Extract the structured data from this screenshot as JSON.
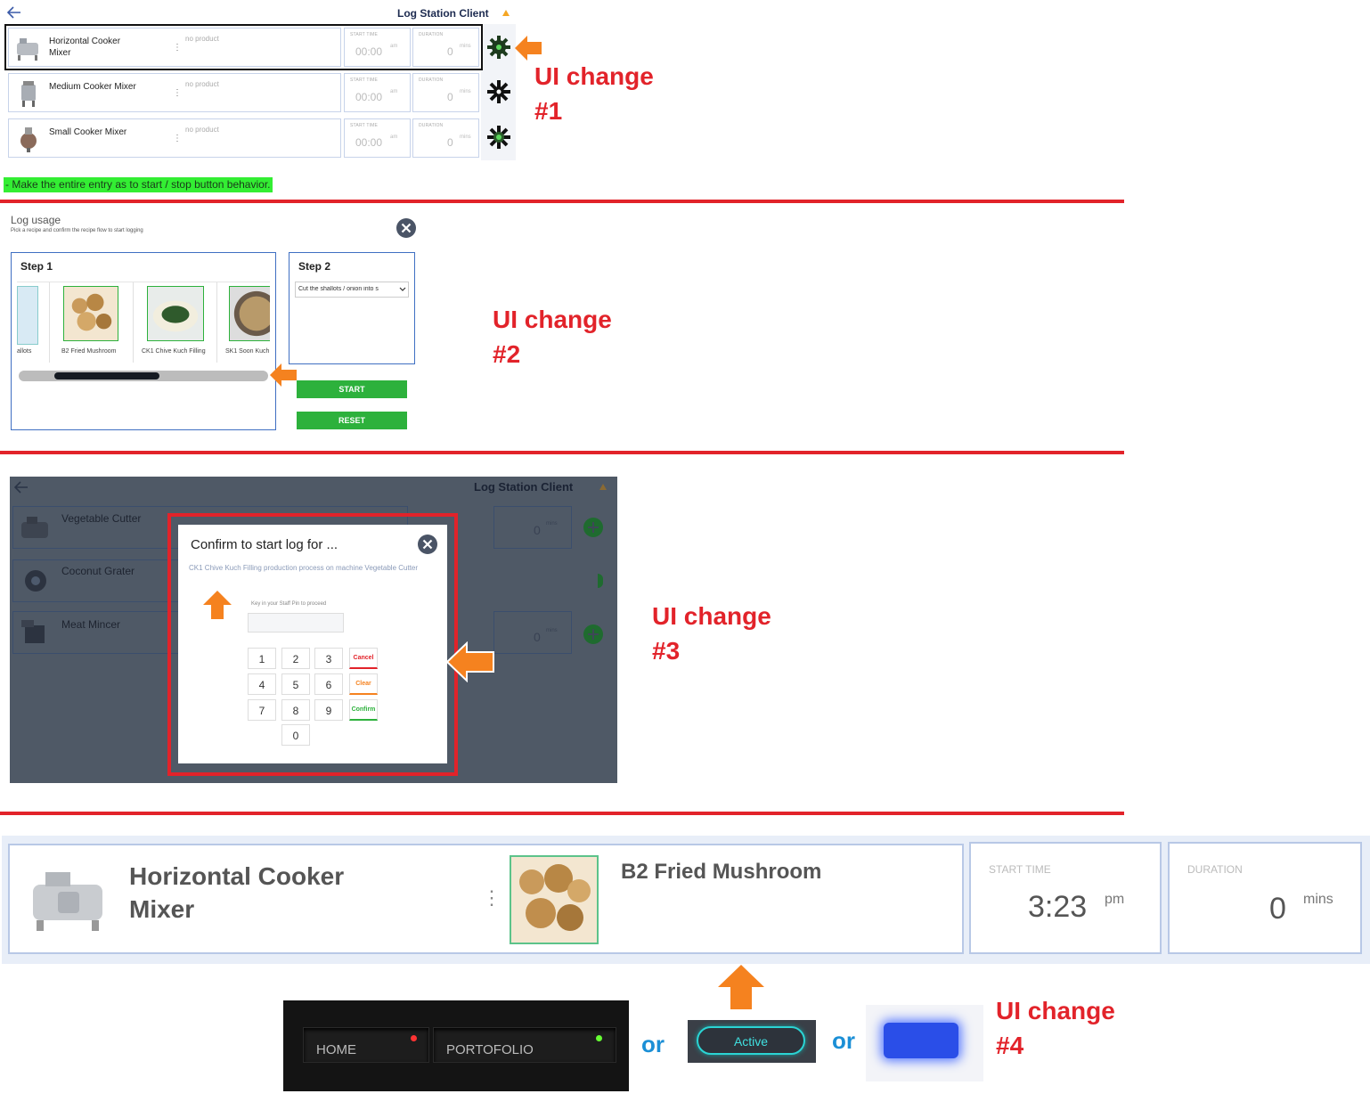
{
  "section1": {
    "app_title": "Log Station Client",
    "rows": [
      {
        "name_line1": "Horizontal Cooker",
        "name_line2": "Mixer",
        "product": "no product",
        "start_label": "START TIME",
        "start_value": "00:00",
        "start_unit": "am",
        "duration_label": "DURATION",
        "duration_value": "0",
        "duration_unit": "mins"
      },
      {
        "name_line1": "Medium Cooker Mixer",
        "name_line2": "",
        "product": "no product",
        "start_label": "START TIME",
        "start_value": "00:00",
        "start_unit": "am",
        "duration_label": "DURATION",
        "duration_value": "0",
        "duration_unit": "mins"
      },
      {
        "name_line1": "Small Cooker Mixer",
        "name_line2": "",
        "product": "no product",
        "start_label": "START TIME",
        "start_value": "00:00",
        "start_unit": "am",
        "duration_label": "DURATION",
        "duration_value": "0",
        "duration_unit": "mins"
      }
    ],
    "note": "- Make the entire entry as to start / stop button behavior.",
    "annotation_line1": "UI change",
    "annotation_line2": "#1"
  },
  "section2": {
    "title": "Log usage",
    "subtitle": "Pick a recipe and confirm the recipe flow to start logging",
    "step1_label": "Step 1",
    "step2_label": "Step 2",
    "recipes": [
      "allots",
      "B2 Fried Mushroom",
      "CK1 Chive Kuch Filling",
      "SK1 Soon Kuch"
    ],
    "step2_select": "Cut the shallots / onion into s",
    "start_label": "START",
    "reset_label": "RESET",
    "scroll_position_fraction": 0.5,
    "annotation_line1": "UI change",
    "annotation_line2": "#2"
  },
  "section3": {
    "app_title": "Log Station Client",
    "machines": [
      "Vegetable Cutter",
      "Coconut Grater",
      "Meat Mincer"
    ],
    "duration_value": "0",
    "duration_unit": "mins",
    "dialog_title": "Confirm to start log for ...",
    "dialog_text": "CK1 Chive Kuch Filling production process on machine Vegetable Cutter",
    "pin_prompt": "Key in your Staff Pin to proceed",
    "keys": [
      "1",
      "2",
      "3",
      "4",
      "5",
      "6",
      "7",
      "8",
      "9",
      "0"
    ],
    "cancel_label": "Cancel",
    "clear_label": "Clear",
    "confirm_label": "Confirm",
    "annotation_line1": "UI change",
    "annotation_line2": "#3"
  },
  "section4": {
    "machine_line1": "Horizontal Cooker",
    "machine_line2": "Mixer",
    "product": "B2 Fried Mushroom",
    "start_label": "START TIME",
    "start_value": "3:23",
    "start_unit": "pm",
    "duration_label": "DURATION",
    "duration_value": "0",
    "duration_unit": "mins",
    "home_label": "HOME",
    "portfolio_label": "PORTOFOLIO",
    "or_label": "or",
    "active_label": "Active",
    "annotation_line1": "UI change",
    "annotation_line2": "#4"
  },
  "colors": {
    "annotation_red": "#e2232a",
    "arrow_orange": "#f5821f",
    "button_green": "#2db13c",
    "or_blue": "#1b8fd6",
    "highlight_green": "#33ee33"
  }
}
